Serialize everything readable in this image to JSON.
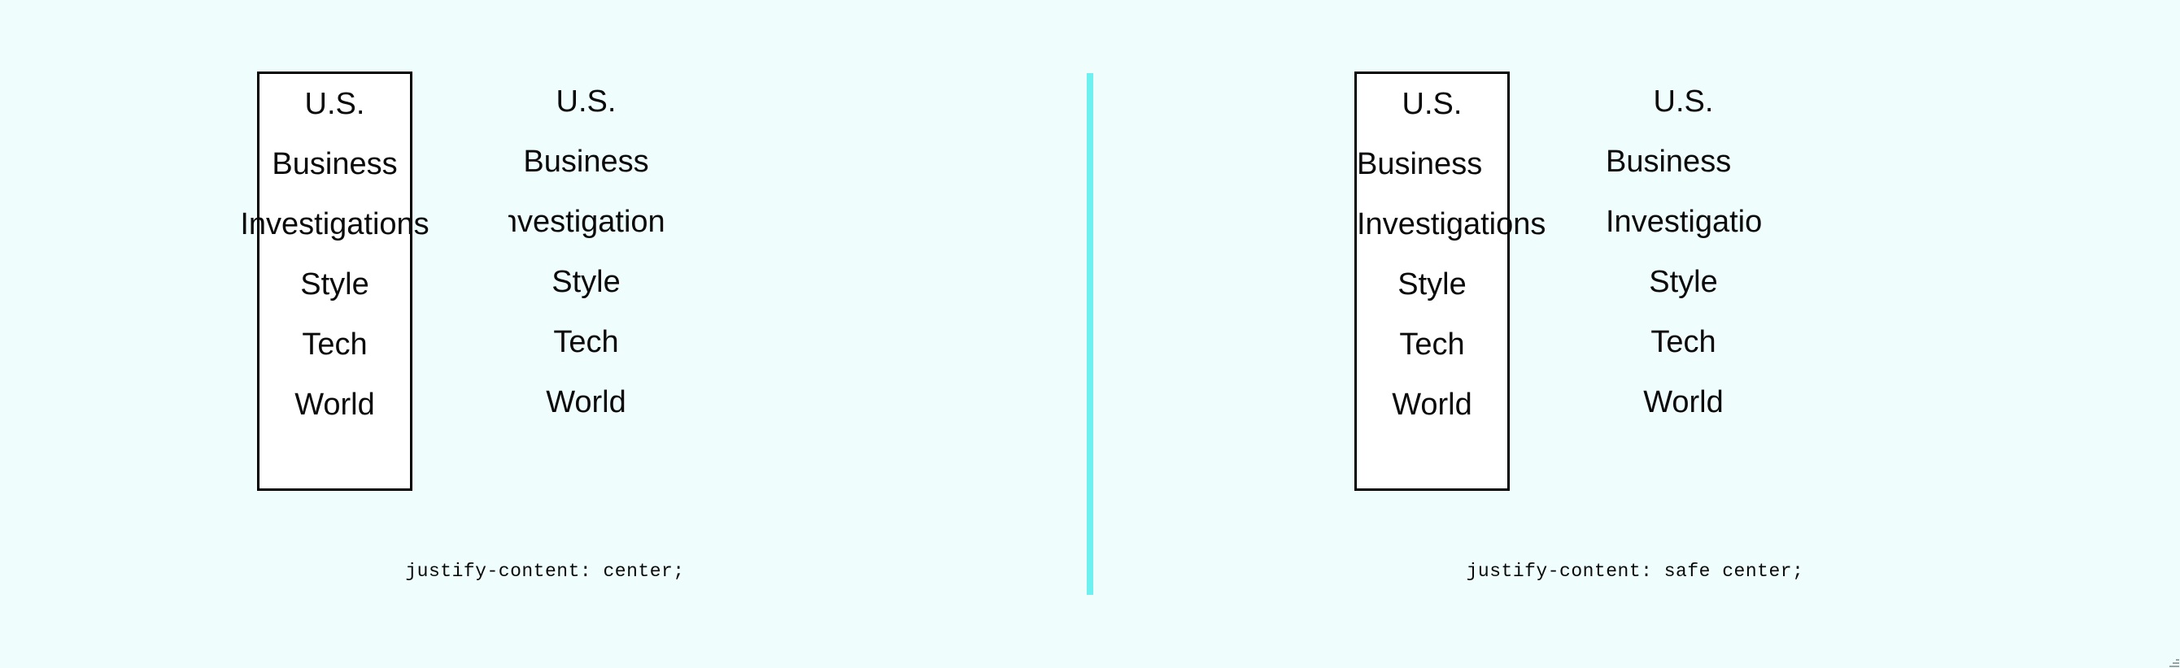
{
  "page": {
    "background_color": "#effdfd",
    "text_color": "#0a0a0a",
    "divider_color": "#6cf0f0",
    "box_border_color": "#000000",
    "box_fill_color": "#ffffff"
  },
  "items": [
    "U.S.",
    "Business",
    "Investigations",
    "Style",
    "Tech",
    "World"
  ],
  "panels": [
    {
      "id": "unsafe-center",
      "caption": "justify-content: center;",
      "mode": "center",
      "columns": [
        {
          "id": "unsafe-center-boxed",
          "clipped": false,
          "rendered_items": [
            "U.S.",
            "Business",
            "Investigations",
            "Style",
            "Tech",
            "World"
          ]
        },
        {
          "id": "unsafe-center-clipped",
          "clipped": true,
          "rendered_items": [
            "U.S.",
            "Business",
            "vestigatio",
            "Style",
            "Tech",
            "World"
          ]
        }
      ]
    },
    {
      "id": "safe-center",
      "caption": "justify-content: safe center;",
      "mode": "safe",
      "columns": [
        {
          "id": "safe-center-boxed",
          "clipped": false,
          "rendered_items": [
            "U.S.",
            "Business",
            "Investigations",
            "Style",
            "Tech",
            "World"
          ]
        },
        {
          "id": "safe-center-clipped",
          "clipped": true,
          "rendered_items": [
            "U.S.",
            "Business",
            "Investiga",
            "Style",
            "Tech",
            "World"
          ]
        }
      ]
    }
  ]
}
